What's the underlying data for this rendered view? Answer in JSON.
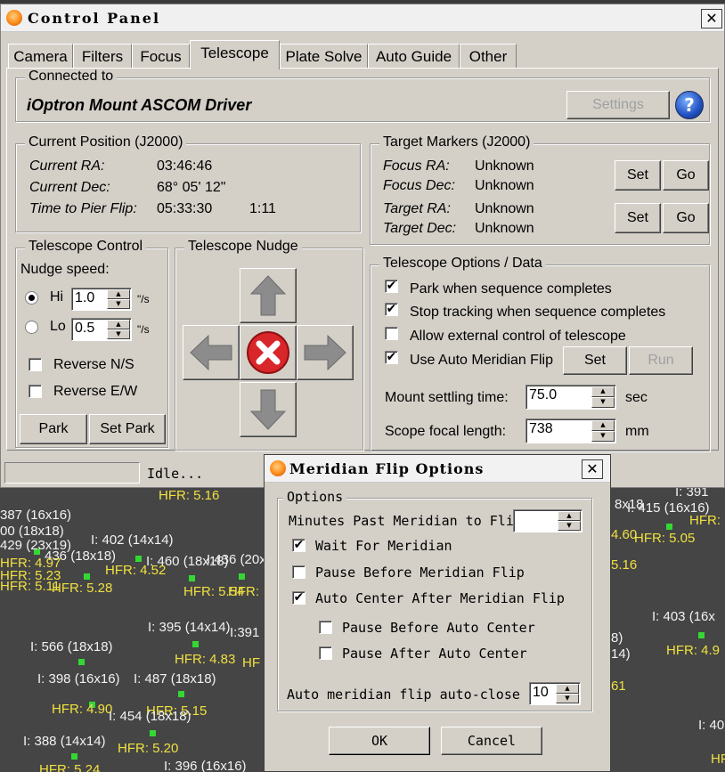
{
  "background": {
    "labels": [
      {
        "t": "HFR: 5.16",
        "c": "y"
      },
      {
        "t": "387 (16x16)",
        "c": "w"
      },
      {
        "t": "00 (18x18)",
        "c": "w"
      },
      {
        "t": "429 (23x19)",
        "c": "w"
      },
      {
        "t": "I: 402 (14x14)",
        "c": "w"
      },
      {
        "t": "436 (18x18)",
        "c": "w"
      },
      {
        "t": "I: 460 (18x18)",
        "c": "w"
      },
      {
        "t": "I:436 (20x",
        "c": "w"
      },
      {
        "t": "HFR: 4.97",
        "c": "y"
      },
      {
        "t": "HFR: 4.52",
        "c": "y"
      },
      {
        "t": "HFR: 5.23",
        "c": "y"
      },
      {
        "t": "HFR: 5.11",
        "c": "y"
      },
      {
        "t": "HFR: 5.28",
        "c": "y"
      },
      {
        "t": "HFR: 5.54",
        "c": "y"
      },
      {
        "t": "HFR: 5.2",
        "c": "y"
      },
      {
        "t": "I: 395 (14x14)",
        "c": "w"
      },
      {
        "t": "I:391",
        "c": "w"
      },
      {
        "t": "I: 566 (18x18)",
        "c": "w"
      },
      {
        "t": "HFR: 4.83",
        "c": "y"
      },
      {
        "t": "HF",
        "c": "y"
      },
      {
        "t": "I: 398 (16x16)",
        "c": "w"
      },
      {
        "t": "I: 487 (18x18)",
        "c": "w"
      },
      {
        "t": "HFR: 4.90",
        "c": "y"
      },
      {
        "t": "HFR: 5.15",
        "c": "y"
      },
      {
        "t": "I: 454 (18x18)",
        "c": "w"
      },
      {
        "t": "I: 388 (14x14)",
        "c": "w"
      },
      {
        "t": "HFR: 5.20",
        "c": "y"
      },
      {
        "t": "HFR: 5.24",
        "c": "y"
      },
      {
        "t": "I: 396 (16x16)",
        "c": "w"
      },
      {
        "t": "I: 391",
        "c": "w"
      },
      {
        "t": "8x18",
        "c": "w"
      },
      {
        "t": "I: 415 (16x16)",
        "c": "w"
      },
      {
        "t": "HFR:",
        "c": "y"
      },
      {
        "t": "4.60",
        "c": "y"
      },
      {
        "t": "HFR: 5.05",
        "c": "y"
      },
      {
        "t": "5.16",
        "c": "y"
      },
      {
        "t": "I: 403 (16x",
        "c": "w"
      },
      {
        "t": "8)",
        "c": "w"
      },
      {
        "t": "14)",
        "c": "w"
      },
      {
        "t": "HFR: 4.9",
        "c": "y"
      },
      {
        "t": "61",
        "c": "y"
      },
      {
        "t": "I: 40",
        "c": "w"
      },
      {
        "t": "HF",
        "c": "y"
      }
    ]
  },
  "control_panel": {
    "title": "Control Panel",
    "close": "✕",
    "tabs": [
      "Camera",
      "Filters",
      "Focus",
      "Telescope",
      "Plate Solve",
      "Auto Guide",
      "Other"
    ],
    "active_tab": "Telescope",
    "connected_label": "Connected to",
    "driver_name": "iOptron Mount ASCOM Driver",
    "settings_btn": "Settings",
    "help_glyph": "?",
    "current_position": {
      "title": "Current Position (J2000)",
      "ra_label": "Current RA:",
      "ra_value": "03:46:46",
      "dec_label": "Current Dec:",
      "dec_value": "68° 05' 12\"",
      "flip_label": "Time to Pier Flip:",
      "flip_value": "05:33:30",
      "flip_extra": "1:11"
    },
    "target_markers": {
      "title": "Target Markers (J2000)",
      "focus_ra_label": "Focus RA:",
      "focus_ra_value": "Unknown",
      "focus_dec_label": "Focus Dec:",
      "focus_dec_value": "Unknown",
      "target_ra_label": "Target RA:",
      "target_ra_value": "Unknown",
      "target_dec_label": "Target Dec:",
      "target_dec_value": "Unknown",
      "set": "Set",
      "go": "Go"
    },
    "telescope_control": {
      "title": "Telescope Control",
      "nudge_speed": "Nudge speed:",
      "hi_label": "Hi",
      "hi_value": "1.0",
      "lo_label": "Lo",
      "lo_value": "0.5",
      "unit": "\"/s",
      "reverse_ns": "Reverse N/S",
      "reverse_ew": "Reverse E/W",
      "park": "Park",
      "set_park": "Set Park"
    },
    "nudge": {
      "title": "Telescope Nudge"
    },
    "options": {
      "title": "Telescope Options / Data",
      "park_when_done": "Park when sequence completes",
      "stop_tracking": "Stop tracking when sequence completes",
      "allow_external": "Allow external control of telescope",
      "use_meridian_flip": "Use Auto Meridian Flip",
      "set": "Set",
      "run": "Run",
      "settle_label": "Mount settling time:",
      "settle_value": "75.0",
      "settle_unit": "sec",
      "focal_label": "Scope focal length:",
      "focal_value": "738",
      "focal_unit": "mm"
    },
    "status_text": "Idle..."
  },
  "meridian_dialog": {
    "title": "Meridian Flip Options",
    "close": "✕",
    "group_title": "Options",
    "minutes_label": "Minutes Past Meridian to Flip:",
    "wait": "Wait For Meridian",
    "pause_before_flip": "Pause Before Meridian Flip",
    "auto_center": "Auto Center After Meridian Flip",
    "pause_before_center": "Pause Before Auto Center",
    "pause_after_center": "Pause After Auto Center",
    "auto_close_label": "Auto meridian flip auto-close",
    "auto_close_value": "10",
    "ok": "OK",
    "cancel": "Cancel"
  }
}
